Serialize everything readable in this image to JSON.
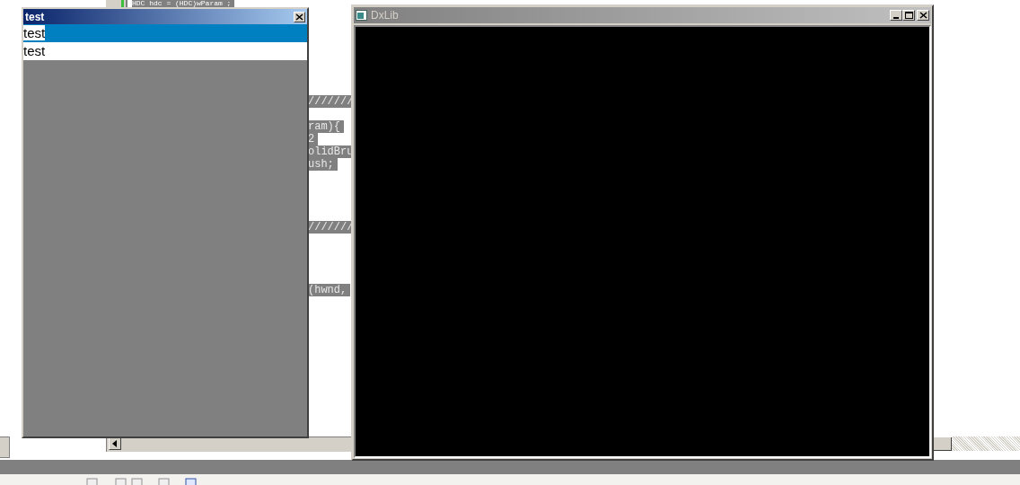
{
  "editor": {
    "code_lines": [
      "HDC hdc = (HDC)wParam ;",
      "///////",
      "ram){",
      "2",
      "olidBru",
      "ush;",
      "///////",
      "(hwnd,"
    ]
  },
  "test_window": {
    "title": "test",
    "items": [
      {
        "label": "test",
        "selected": true
      },
      {
        "label": "test",
        "selected": false
      }
    ]
  },
  "dxlib_window": {
    "title": "DxLib"
  }
}
